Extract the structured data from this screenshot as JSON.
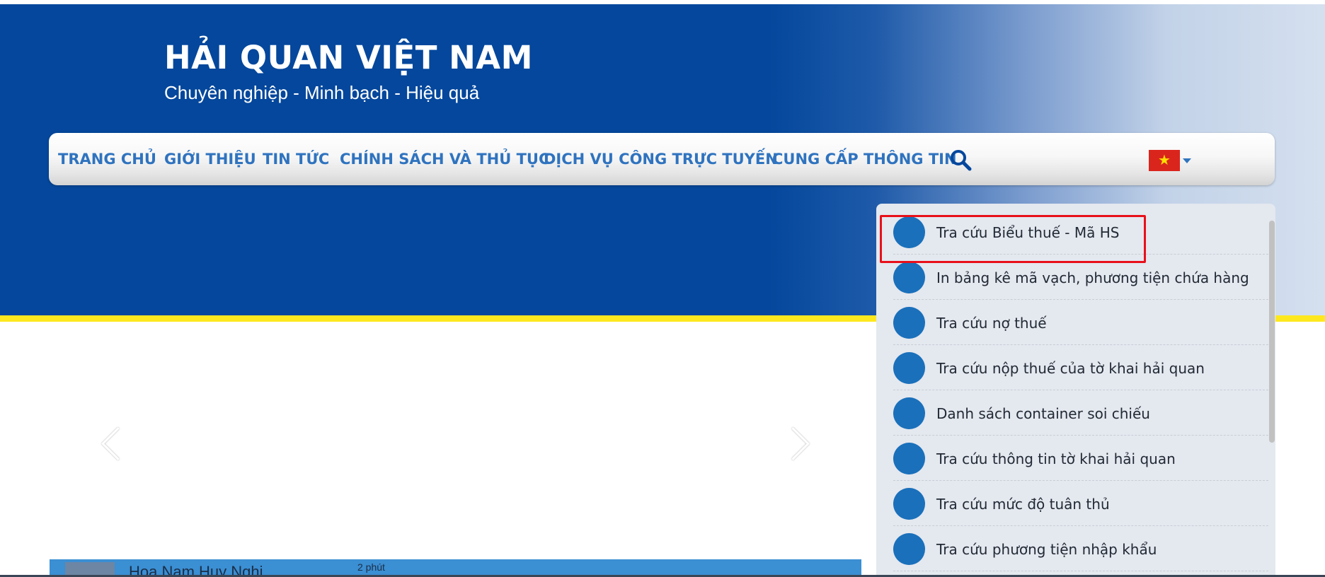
{
  "header": {
    "title": "HẢI QUAN VIỆT NAM",
    "slogan": "Chuyên nghiệp - Minh bạch - Hiệu quả"
  },
  "nav": {
    "items": [
      {
        "label": "TRANG CHỦ"
      },
      {
        "label": "GIỚI THIỆU"
      },
      {
        "label": "TIN TỨC"
      },
      {
        "label": "CHÍNH SÁCH VÀ THỦ TỤC"
      },
      {
        "label": "DỊCH VỤ CÔNG TRỰC TUYẾN"
      },
      {
        "label": "CUNG CẤP THÔNG TIN"
      }
    ],
    "search_icon": "search-icon",
    "language_flag": "vietnam-flag-icon",
    "flag_star": "★"
  },
  "colors": {
    "primary_blue": "#04479c",
    "nav_text": "#2f73bf",
    "accent_yellow": "#fde81f",
    "highlight_red": "#e8101a",
    "dot_blue": "#1a70bb",
    "panel_bg": "#e4e8ef"
  },
  "quick_links": {
    "items": [
      {
        "label": "Tra cứu Biểu thuế - Mã HS",
        "highlighted": true
      },
      {
        "label": "In bảng kê mã vạch, phương tiện chứa hàng"
      },
      {
        "label": "Tra cứu nợ thuế"
      },
      {
        "label": "Tra cứu nộp thuế của tờ khai hải quan"
      },
      {
        "label": "Danh sách container soi chiếu"
      },
      {
        "label": "Tra cứu thông tin tờ khai hải quan"
      },
      {
        "label": "Tra cứu mức độ tuân thủ"
      },
      {
        "label": "Tra cứu phương tiện nhập khẩu"
      }
    ]
  },
  "carousel": {
    "prev_icon": "chevron-left-icon",
    "next_icon": "chevron-right-icon"
  },
  "news_strip": {
    "title": "Hoa Nam Huy Nghi",
    "time": "2 phút"
  }
}
